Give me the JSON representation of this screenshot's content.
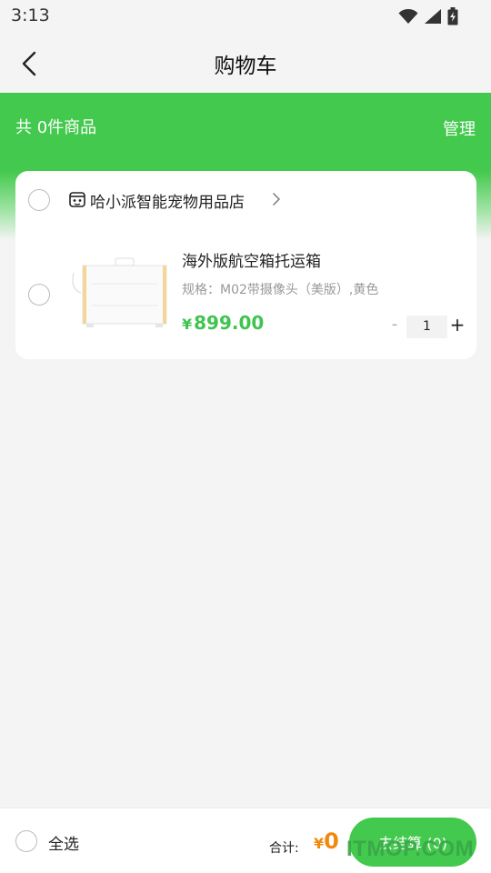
{
  "status_bar": {
    "time": "3:13",
    "icons": [
      "wifi-icon",
      "signal-icon",
      "battery-charging-icon"
    ]
  },
  "nav": {
    "title": "购物车",
    "back_icon": "back-arrow-icon"
  },
  "summary": {
    "item_count_text": "共 0件商品",
    "manage_label": "管理"
  },
  "store": {
    "name": "哈小派智能宠物用品店",
    "icon": "store-icon",
    "items": [
      {
        "title": "海外版航空箱托运箱",
        "spec": "规格：M02带摄像头（美版）,黄色",
        "price_symbol": "¥",
        "price": "899.00",
        "quantity": "1",
        "minus_label": "-",
        "plus_label": "+"
      }
    ]
  },
  "bottom_bar": {
    "select_all_label": "全选",
    "total_label": "合计:",
    "total_symbol": "¥",
    "total_amount": "0",
    "checkout_label": "去结算 (0)"
  },
  "watermark": "ITMOP.COM",
  "colors": {
    "brand_green": "#43c94d",
    "price_green": "#3fc451",
    "total_orange": "#f08a0e",
    "background": "#f4f4f4"
  }
}
